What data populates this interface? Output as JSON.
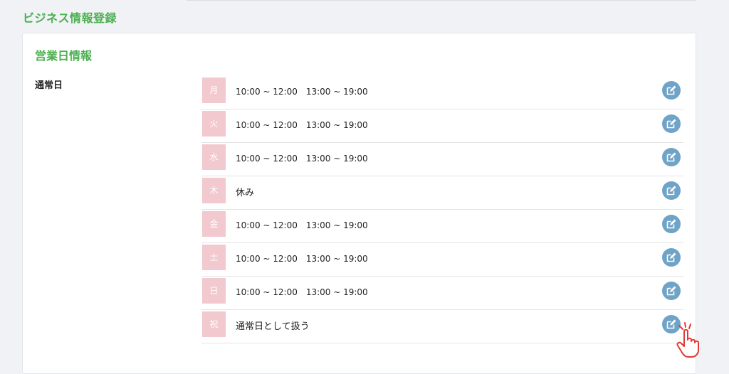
{
  "page": {
    "title": "ビジネス情報登録"
  },
  "section": {
    "title": "営業日情報",
    "field_label": "通常日"
  },
  "schedule": [
    {
      "day": "月",
      "hours": "10:00 ~ 12:00　13:00 ~ 19:00"
    },
    {
      "day": "火",
      "hours": "10:00 ~ 12:00　13:00 ~ 19:00"
    },
    {
      "day": "水",
      "hours": "10:00 ~ 12:00　13:00 ~ 19:00"
    },
    {
      "day": "木",
      "hours": "休み"
    },
    {
      "day": "金",
      "hours": "10:00 ~ 12:00　13:00 ~ 19:00"
    },
    {
      "day": "土",
      "hours": "10:00 ~ 12:00　13:00 ~ 19:00"
    },
    {
      "day": "日",
      "hours": "10:00 ~ 12:00　13:00 ~ 19:00"
    },
    {
      "day": "祝",
      "hours": "通常日として扱う"
    }
  ],
  "icons": {
    "edit": "edit-icon",
    "cursor": "pointer-hand-icon"
  },
  "colors": {
    "accent_green": "#4caf50",
    "day_badge": "#f2c9cf",
    "edit_button": "#6fa3c7",
    "cursor_red": "#e53935"
  }
}
